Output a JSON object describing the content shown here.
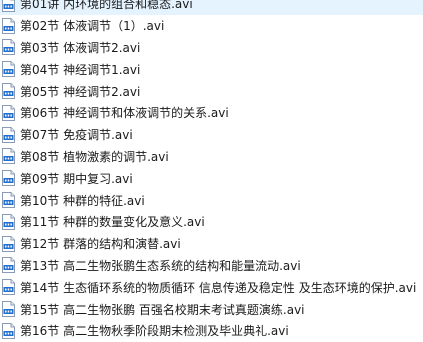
{
  "files": [
    {
      "name": "第01讲 内环境的组合和稳态.avi",
      "icon": "video-file-icon"
    },
    {
      "name": "第02节 体液调节（1）.avi",
      "icon": "video-file-icon"
    },
    {
      "name": "第03节 体液调节2.avi",
      "icon": "video-file-icon"
    },
    {
      "name": "第04节 神经调节1.avi",
      "icon": "video-file-icon"
    },
    {
      "name": "第05节 神经调节2.avi",
      "icon": "video-file-icon"
    },
    {
      "name": "第06节 神经调节和体液调节的关系.avi",
      "icon": "video-file-icon"
    },
    {
      "name": "第07节 免疫调节.avi",
      "icon": "video-file-icon"
    },
    {
      "name": "第08节 植物激素的调节.avi",
      "icon": "video-file-icon"
    },
    {
      "name": "第09节 期中复习.avi",
      "icon": "video-file-icon"
    },
    {
      "name": "第10节 种群的特征.avi",
      "icon": "video-file-icon"
    },
    {
      "name": "第11节 种群的数量变化及意义.avi",
      "icon": "video-file-icon"
    },
    {
      "name": "第12节 群落的结构和演替.avi",
      "icon": "video-file-icon"
    },
    {
      "name": "第13节 高二生物张鹏生态系统的结构和能量流动.avi",
      "icon": "video-file-icon"
    },
    {
      "name": "第14节 生态循环系统的物质循环 信息传递及稳定性 及生态环境的保护.avi",
      "icon": "video-file-icon"
    },
    {
      "name": "第15节 高二生物张鹏 百强名校期末考试真题演练.avi",
      "icon": "video-file-icon"
    },
    {
      "name": "第16节 高二生物秋季阶段期末检测及毕业典礼.avi",
      "icon": "video-file-icon"
    }
  ],
  "colors": {
    "icon_blue": "#1f6fd0",
    "icon_label": "AVI"
  }
}
